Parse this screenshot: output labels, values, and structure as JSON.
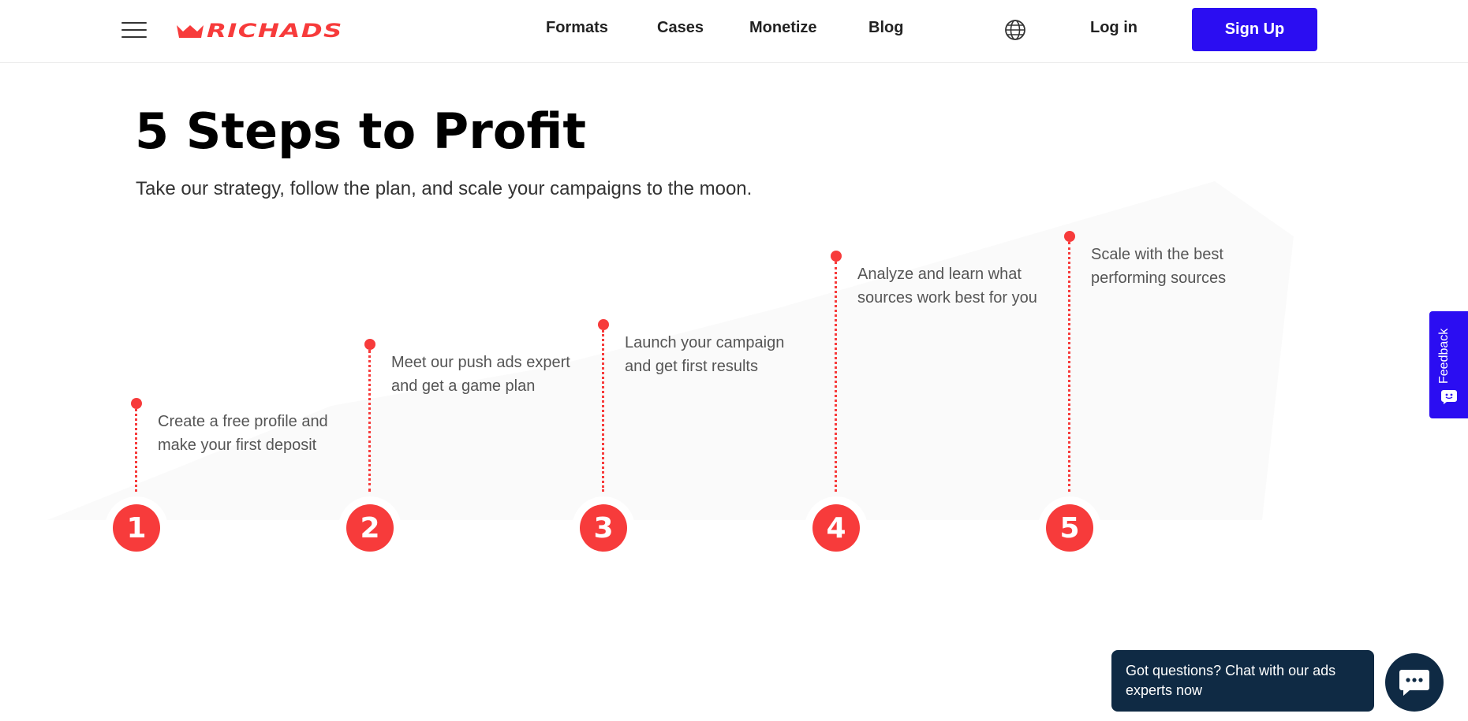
{
  "header": {
    "logo_text": "RICHADS",
    "nav": [
      {
        "label": "Formats"
      },
      {
        "label": "Cases"
      },
      {
        "label": "Monetize"
      },
      {
        "label": "Blog"
      }
    ],
    "login_label": "Log in",
    "signup_label": "Sign Up"
  },
  "hero": {
    "title": "5 Steps to Profit",
    "subtitle": "Take our strategy, follow the plan, and scale your campaigns to the moon."
  },
  "steps": [
    {
      "number": "1",
      "text": "Create a free profile and make your first deposit"
    },
    {
      "number": "2",
      "text": "Meet our push ads expert and get a game plan"
    },
    {
      "number": "3",
      "text": "Launch your campaign and get first results"
    },
    {
      "number": "4",
      "text": "Analyze and learn what sources work best for you"
    },
    {
      "number": "5",
      "text": "Scale with the best performing sources"
    }
  ],
  "feedback": {
    "label": "Feedback"
  },
  "chat": {
    "prompt": "Got questions? Chat with our ads experts now"
  },
  "colors": {
    "accent_red": "#f73b3b",
    "brand_blue": "#2b0df2",
    "chat_navy": "#0f2a44"
  },
  "icons": [
    "hamburger-menu-icon",
    "globe-icon",
    "feedback-smile-icon",
    "chat-dots-icon"
  ]
}
